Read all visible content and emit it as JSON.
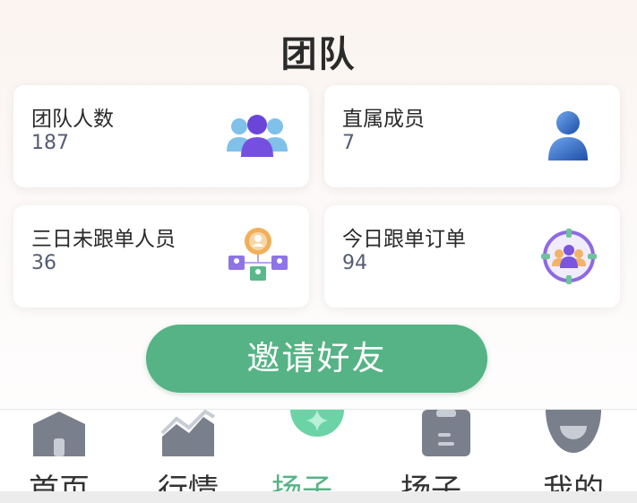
{
  "header": {
    "title": "团队"
  },
  "cards": [
    {
      "title": "团队人数",
      "value": "187",
      "icon": "team-members-icon"
    },
    {
      "title": "直属成员",
      "value": "7",
      "icon": "single-member-icon"
    },
    {
      "title": "三日未跟单人员",
      "value": "36",
      "icon": "org-chart-icon"
    },
    {
      "title": "今日跟单订单",
      "value": "94",
      "icon": "target-group-icon"
    }
  ],
  "invite_button": {
    "label": "邀请好友"
  },
  "tabbar": {
    "active_color": "#55b385",
    "items": [
      {
        "label": "首页",
        "icon": "home-icon"
      },
      {
        "label": "行情",
        "icon": "market-chart-icon"
      },
      {
        "label": "扬子…",
        "icon": "sparkle-icon"
      },
      {
        "label": "扬子…",
        "icon": "clipboard-icon"
      },
      {
        "label": "我的",
        "icon": "profile-icon"
      }
    ]
  }
}
